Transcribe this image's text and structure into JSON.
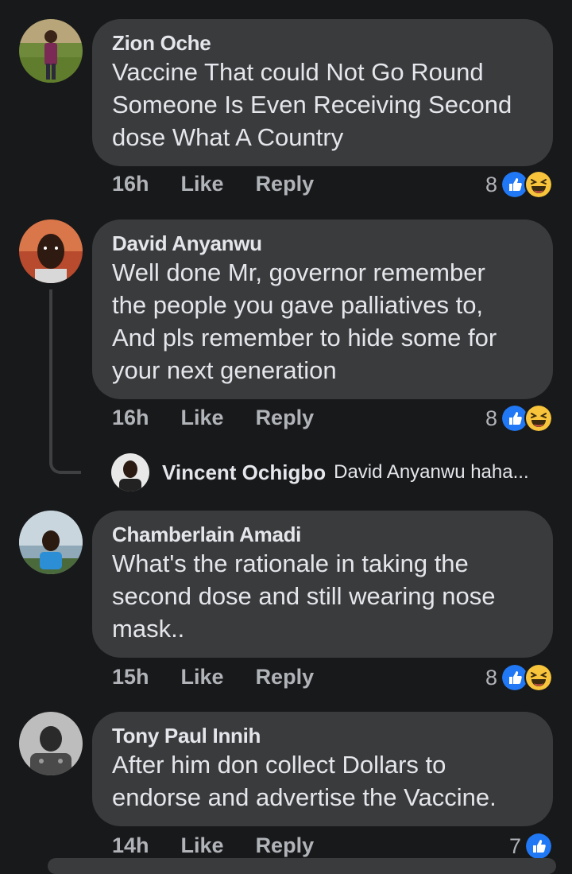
{
  "comments": [
    {
      "name": "Zion Oche",
      "text": "Vaccine That could Not Go Round\nSomeone Is Even Receiving Second\ndose What A Country",
      "time": "16h",
      "like": "Like",
      "reply": "Reply",
      "reaction_count": "8"
    },
    {
      "name": "David Anyanwu",
      "text": "Well done Mr, governor remember\nthe people you gave palliatives to,\nAnd pls remember to hide some for\nyour next generation",
      "time": "16h",
      "like": "Like",
      "reply": "Reply",
      "reaction_count": "8",
      "reply_preview": {
        "name": "Vincent Ochigbo",
        "text": "David Anyanwu haha..."
      }
    },
    {
      "name": "Chamberlain Amadi",
      "text": "What's the rationale in taking the\nsecond dose and still wearing nose\nmask..",
      "time": "15h",
      "like": "Like",
      "reply": "Reply",
      "reaction_count": "8"
    },
    {
      "name": "Tony Paul Innih",
      "text": "After him don collect Dollars to\nendorse and advertise the Vaccine.",
      "time": "14h",
      "like": "Like",
      "reply": "Reply",
      "reaction_count": "7"
    }
  ],
  "icons": {
    "like_reaction": "like-reaction-icon",
    "haha_reaction": "haha-reaction-icon"
  },
  "colors": {
    "background": "#18191a",
    "bubble": "#3a3b3c",
    "like_blue": "#2078f4",
    "haha_yellow": "#f7c43b",
    "secondary_text": "#b0b3b8"
  }
}
